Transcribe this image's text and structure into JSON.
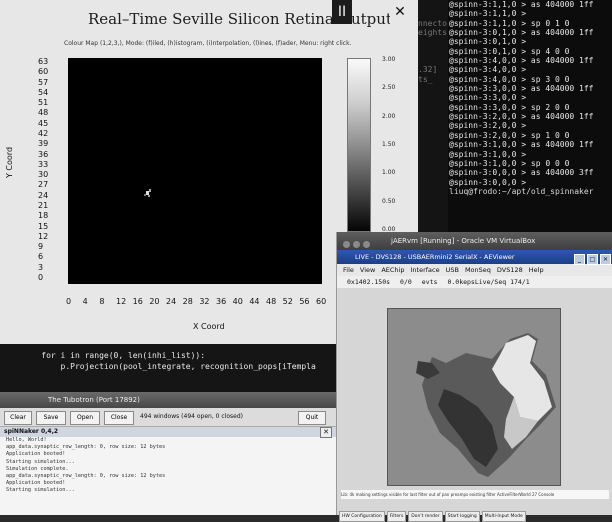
{
  "terminal": {
    "lines": [
      "@spinn-3:1,1,0 > as 404000 1ff",
      "@spinn-3:1,1,0 >",
      "@spinn-3:1,1,0 > sp 0 1 0",
      "@spinn-3:0,1,0 > as 404000 1ff",
      "@spinn-3:0,1,0 >",
      "@spinn-3:0,1,0 > sp 4 0 0",
      "@spinn-3:4,0,0 > as 404000 1ff",
      "@spinn-3:4,0,0 >",
      "@spinn-3:4,0,0 > sp 3 0 0",
      "@spinn-3:3,0,0 > as 404000 1ff",
      "@spinn-3:3,0,0 >",
      "@spinn-3:3,0,0 > sp 2 0 0",
      "@spinn-3:2,0,0 > as 404000 1ff",
      "@spinn-3:2,0,0 >",
      "@spinn-3:2,0,0 > sp 1 0 0",
      "@spinn-3:1,0,0 > as 404000 1ff",
      "@spinn-3:1,0,0 >",
      "@spinn-3:1,0,0 > sp 0 0 0",
      "@spinn-3:0,0,0 > as 404000 3ff",
      "@spinn-3:0,0,0 >"
    ],
    "prompt": "liuq@frodo:~/apt/old_spinnaker",
    "left_fragments": [
      "",
      "",
      "nnecto",
      "eights",
      "",
      "",
      "",
      ".32]",
      "ts_",
      "",
      "",
      "",
      "",
      "",
      "",
      "",
      "",
      "",
      "",
      ""
    ]
  },
  "retina": {
    "title": "Real–Time Seville Silicon Retina Output",
    "subtitle": "Colour Map (1,2,3,), Mode: (f)iled, (h)istogram, (i)nterpolation, (l)ines, (f)ader, Menu: right click.",
    "pause_glyph": "II",
    "close_glyph": "✕",
    "chart_data": {
      "type": "heatmap",
      "xlabel": "X Coord",
      "ylabel": "Y Coord",
      "x_ticks": [
        "0",
        "4",
        "8",
        "12",
        "16",
        "20",
        "24",
        "28",
        "32",
        "36",
        "40",
        "44",
        "48",
        "52",
        "56",
        "60"
      ],
      "y_ticks": [
        "63",
        "60",
        "57",
        "54",
        "51",
        "48",
        "45",
        "42",
        "39",
        "36",
        "33",
        "30",
        "27",
        "24",
        "21",
        "18",
        "15",
        "12",
        "9",
        "6",
        "3",
        "0"
      ],
      "colorbar_ticks": [
        "3.00",
        "2.50",
        "2.00",
        "1.50",
        "1.00",
        "0.50",
        "0.00"
      ],
      "colorbar_range": [
        0,
        3
      ]
    }
  },
  "code": {
    "line1": "    for i in range(0, len(inhi_list)):",
    "line2": "        p.Projection(pool_integrate, recognition_pops[iTempla"
  },
  "tubotron": {
    "title": "The Tubotron (Port 17892)",
    "buttons": [
      "Clear",
      "Save",
      "Open",
      "Close"
    ],
    "window_count": "494 windows (494 open, 0 closed)",
    "quit_label": "Quit",
    "tab": "spiNNaker 0,4,2",
    "tab_close": "✕",
    "log": [
      "Hello, World!",
      "app_data.synaptic_row_length: 0, row size: 12 bytes",
      "Application booted!",
      "Starting simulation...",
      "Simulation complete.",
      "app_data.synaptic_row_length: 0, row size: 12 bytes",
      "Application booted!",
      "Starting simulation..."
    ]
  },
  "vbox": {
    "title": "jAERvm [Running] - Oracle VM VirtualBox",
    "jaer": {
      "title": "LIVE - DVS128 - USBAERmini2 SerialX - AEViewer",
      "window_controls": [
        "_",
        "□",
        "✕"
      ],
      "menu": [
        "File",
        "View",
        "AEChip",
        "Interface",
        "USB",
        "MonSeq",
        "DVS128",
        "Help"
      ],
      "status": [
        "0x1402.150s",
        "0/0",
        "evts",
        "0.0kepsLive/Seq 174/1"
      ],
      "tip": "Lib: 4k making settings visible for last filter out of pan preamps existing filter ActiveFilterWorld 27 Console",
      "bottom_buttons": [
        "HW Configuration",
        "Filters",
        "Don't render",
        "Start logging",
        "Multi-Input Mode"
      ]
    }
  }
}
